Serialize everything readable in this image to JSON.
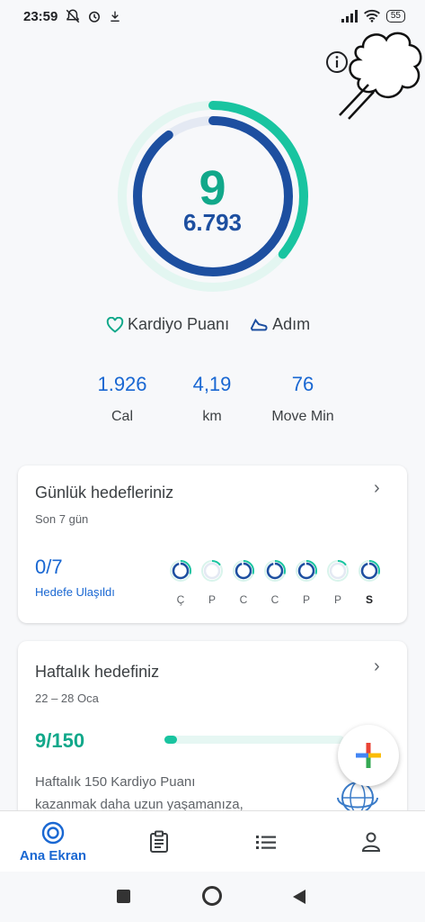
{
  "status_bar": {
    "time": "23:59",
    "battery": "55"
  },
  "rings": {
    "cardio_value": "9",
    "steps_value": "6.793",
    "cardio_fraction": 0.36,
    "steps_fraction": 0.9
  },
  "legend": {
    "cardio_label": "Kardiyo Puanı",
    "steps_label": "Adım"
  },
  "stats": [
    {
      "value": "1.926",
      "label": "Cal"
    },
    {
      "value": "4,19",
      "label": "km"
    },
    {
      "value": "76",
      "label": "Move Min"
    }
  ],
  "daily_goals": {
    "title": "Günlük hedefleriniz",
    "subtitle": "Son 7 gün",
    "achieved": "0/7",
    "achieved_label": "Hedefe Ulaşıldı",
    "days": [
      "Ç",
      "P",
      "C",
      "C",
      "P",
      "P",
      "S"
    ]
  },
  "weekly_goal": {
    "title": "Haftalık hedefiniz",
    "date_range": "22 – 28 Oca",
    "progress": "9/150",
    "progress_fraction": 0.06,
    "description_line1": "Haftalık 150 Kardiyo Puanı",
    "description_line2": "kazanmak daha uzun yaşamanıza,"
  },
  "bottom_nav": {
    "home_label": "Ana Ekran"
  },
  "colors": {
    "accent_green": "#11a88a",
    "accent_blue": "#1d4fa0",
    "link_blue": "#1967d2"
  }
}
